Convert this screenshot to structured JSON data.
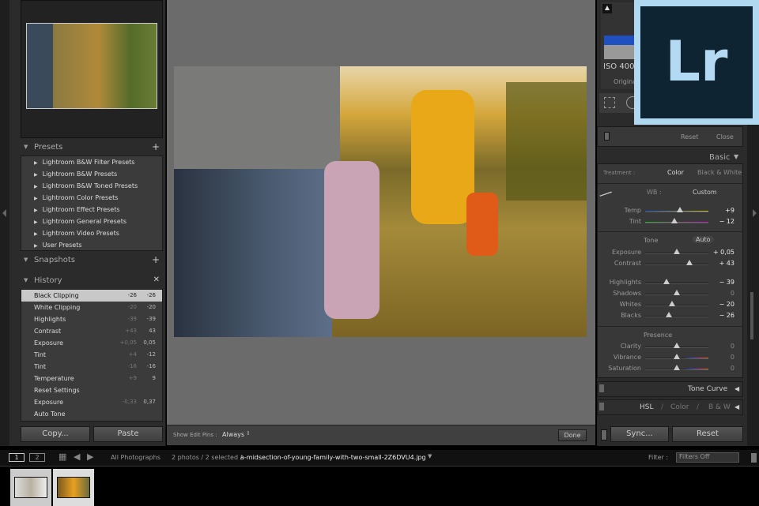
{
  "left": {
    "presets_title": "Presets",
    "presets": [
      "Lightroom B&W Filter Presets",
      "Lightroom B&W Presets",
      "Lightroom B&W Toned Presets",
      "Lightroom Color Presets",
      "Lightroom Effect Presets",
      "Lightroom General Presets",
      "Lightroom Video Presets",
      "User Presets"
    ],
    "snapshots_title": "Snapshots",
    "history_title": "History",
    "history": [
      {
        "label": "Black Clipping",
        "from": "-26",
        "to": "-26"
      },
      {
        "label": "White Clipping",
        "from": "-20",
        "to": "-20"
      },
      {
        "label": "Highlights",
        "from": "-39",
        "to": "-39"
      },
      {
        "label": "Contrast",
        "from": "+43",
        "to": "43"
      },
      {
        "label": "Exposure",
        "from": "+0,05",
        "to": "0,05"
      },
      {
        "label": "Tint",
        "from": "+4",
        "to": "-12"
      },
      {
        "label": "Tint",
        "from": "-16",
        "to": "-16"
      },
      {
        "label": "Temperature",
        "from": "+9",
        "to": "9"
      },
      {
        "label": "Reset Settings",
        "from": "",
        "to": ""
      },
      {
        "label": "Exposure",
        "from": "-0,33",
        "to": "0,37"
      },
      {
        "label": "Auto Tone",
        "from": "",
        "to": ""
      }
    ],
    "copy": "Copy...",
    "paste": "Paste"
  },
  "toolbar": {
    "show_edit_pins": "Show Edit Pins :",
    "pins_value": "Always",
    "done": "Done"
  },
  "right": {
    "iso": "ISO 400",
    "original": "Original",
    "reset": "Reset",
    "close": "Close",
    "basic": "Basic",
    "treatment": "Treatment :",
    "color": "Color",
    "bw": "Black & White",
    "wb": "WB :",
    "wb_value": "Custom",
    "tone": "Tone",
    "auto": "Auto",
    "presence": "Presence",
    "sliders": [
      {
        "label": "Temp",
        "value": "+9",
        "pos": 0.55
      },
      {
        "label": "Tint",
        "value": "− 12",
        "pos": 0.46
      },
      {
        "label": "Exposure",
        "value": "+ 0,05",
        "pos": 0.5
      },
      {
        "label": "Contrast",
        "value": "+ 43",
        "pos": 0.7
      },
      {
        "label": "Highlights",
        "value": "− 39",
        "pos": 0.34
      },
      {
        "label": "Shadows",
        "value": "0",
        "pos": 0.5
      },
      {
        "label": "Whites",
        "value": "− 20",
        "pos": 0.42
      },
      {
        "label": "Blacks",
        "value": "− 26",
        "pos": 0.38
      },
      {
        "label": "Clarity",
        "value": "0",
        "pos": 0.5
      },
      {
        "label": "Vibrance",
        "value": "0",
        "pos": 0.5
      },
      {
        "label": "Saturation",
        "value": "0",
        "pos": 0.5
      }
    ],
    "tone_curve": "Tone Curve",
    "hsl": "HSL",
    "hsl_color": "Color",
    "hsl_bw": "B & W",
    "sep": "/",
    "sync": "Sync...",
    "reset_btn": "Reset"
  },
  "logo": "Lr",
  "filmstrip": {
    "page1": "1",
    "page2": "2",
    "source": "All Photographs",
    "count": "2 photos / 2 selected /",
    "filename": "a-midsection-of-young-family-with-two-small-2Z6DVU4.jpg",
    "filter_label": "Filter :",
    "filter_value": "Filters Off"
  }
}
